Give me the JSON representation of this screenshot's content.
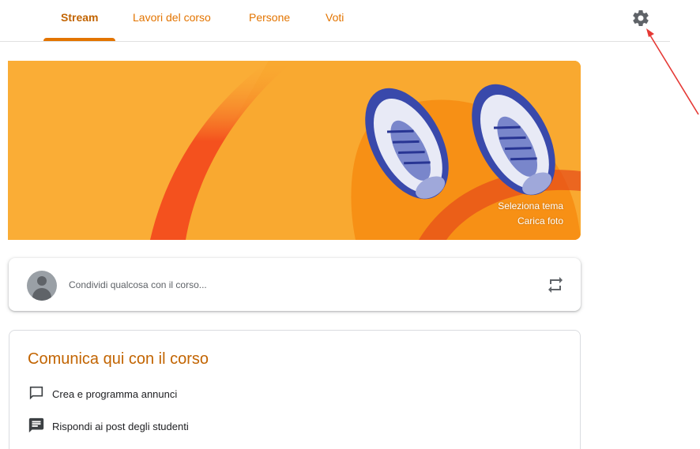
{
  "nav": {
    "tabs": [
      {
        "label": "Stream",
        "active": true
      },
      {
        "label": "Lavori del corso",
        "active": false
      },
      {
        "label": "Persone",
        "active": false
      },
      {
        "label": "Voti",
        "active": false
      }
    ],
    "settings_icon": "gear-icon"
  },
  "banner": {
    "select_theme": "Seleziona tema",
    "upload_photo": "Carica foto"
  },
  "share": {
    "placeholder": "Condividi qualcosa con il corso...",
    "avatar_icon": "default-avatar",
    "action_icon": "repost-icon"
  },
  "card": {
    "title": "Comunica qui con il corso",
    "items": [
      {
        "icon": "chat-bubble-icon",
        "label": "Crea e programma annunci"
      },
      {
        "icon": "message-icon",
        "label": "Rispondi ai post degli studenti"
      }
    ]
  },
  "colors": {
    "accent": "#e37400",
    "banner": "#f9a930",
    "annotation": "#e53935"
  }
}
